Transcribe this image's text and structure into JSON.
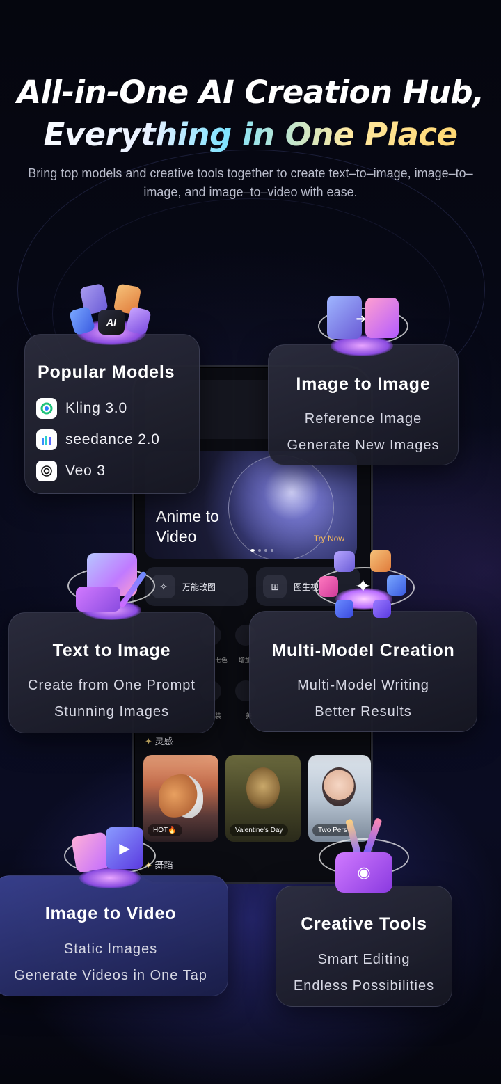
{
  "headline": {
    "line1": "All-in-One AI Creation Hub,",
    "line2": "Everything in One Place"
  },
  "subtitle": "Bring top models and creative tools together to create text–to–image, image–to–image, and image–to–video with ease.",
  "phone": {
    "banner": {
      "title_line1": "Anime to",
      "title_line2": "Video",
      "cta": "Try Now"
    },
    "pills": [
      {
        "label": "万能改图"
      },
      {
        "label": "图生视"
      }
    ],
    "ghost_labels": [
      "七色",
      "增加",
      "装",
      "美"
    ],
    "inspiration": {
      "title": "灵感",
      "items": [
        {
          "tag": "HOT🔥"
        },
        {
          "tag": "Valentine's Day"
        },
        {
          "tag": "Two Pers"
        }
      ]
    },
    "dance": {
      "title": "舞蹈"
    }
  },
  "cards": {
    "popular_models": {
      "title": "Popular Models",
      "items": [
        {
          "name": "Kling 3.0",
          "icon": "kling-logo-icon"
        },
        {
          "name": "seedance 2.0",
          "icon": "seedance-logo-icon"
        },
        {
          "name": "Veo 3",
          "icon": "openai-logo-icon"
        }
      ],
      "badge_text": "AI"
    },
    "image_to_image": {
      "title": "Image to Image",
      "line1": "Reference Image",
      "line2": "Generate New Images"
    },
    "text_to_image": {
      "title": "Text to Image",
      "line1": "Create from One Prompt",
      "line2": "Stunning Images"
    },
    "multi_model": {
      "title": "Multi-Model Creation",
      "line1": "Multi-Model Writing",
      "line2": "Better Results"
    },
    "image_to_video": {
      "title": "Image to Video",
      "line1": "Static Images",
      "line2": "Generate Videos in One Tap"
    },
    "creative_tools": {
      "title": "Creative Tools",
      "line1": "Smart Editing",
      "line2": "Endless Possibilities"
    }
  },
  "colors": {
    "background": "#05060f",
    "accent_gold": "#f2b75c",
    "accent_cyan": "#7fe3ff",
    "card": "#2d2e3e"
  }
}
